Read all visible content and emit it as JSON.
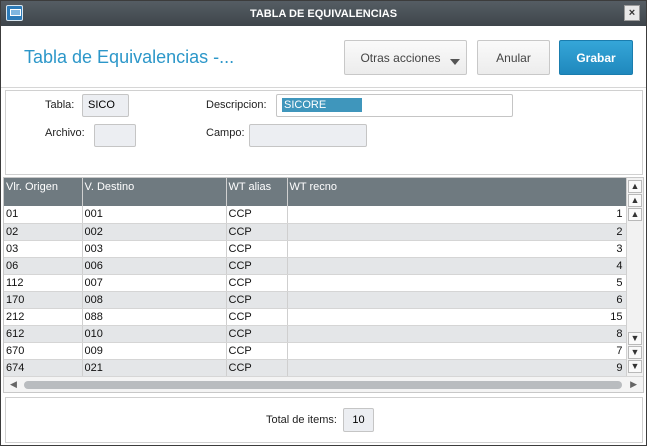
{
  "window": {
    "title": "TABLA DE EQUIVALENCIAS",
    "close_glyph": "×"
  },
  "header": {
    "page_title": "Tabla de Equivalencias -...",
    "buttons": {
      "otras": "Otras acciones",
      "anular": "Anular",
      "grabar": "Grabar"
    }
  },
  "form": {
    "tabla": {
      "label": "Tabla:",
      "value": "SICO"
    },
    "descripcion": {
      "label": "Descripcion:",
      "value": "SICORE"
    },
    "archivo": {
      "label": "Archivo:",
      "value": ""
    },
    "campo": {
      "label": "Campo:",
      "value": ""
    }
  },
  "grid": {
    "columns": [
      "Vlr. Origen",
      "V. Destino",
      "WT alias",
      "WT recno"
    ],
    "rows": [
      [
        "01",
        "001",
        "CCP",
        "1"
      ],
      [
        "02",
        "002",
        "CCP",
        "2"
      ],
      [
        "03",
        "003",
        "CCP",
        "3"
      ],
      [
        "06",
        "006",
        "CCP",
        "4"
      ],
      [
        "112",
        "007",
        "CCP",
        "5"
      ],
      [
        "170",
        "008",
        "CCP",
        "6"
      ],
      [
        "212",
        "088",
        "CCP",
        "15"
      ],
      [
        "612",
        "010",
        "CCP",
        "8"
      ],
      [
        "670",
        "009",
        "CCP",
        "7"
      ],
      [
        "674",
        "021",
        "CCP",
        "9"
      ]
    ]
  },
  "footer": {
    "total_label": "Total de items:",
    "total_value": "10"
  },
  "colors": {
    "accent": "#2c97c9",
    "primary_button": "#1f88bd",
    "titlebar": "#4a5258",
    "grid_header": "#6f7a80",
    "selection": "#3f96bc"
  }
}
